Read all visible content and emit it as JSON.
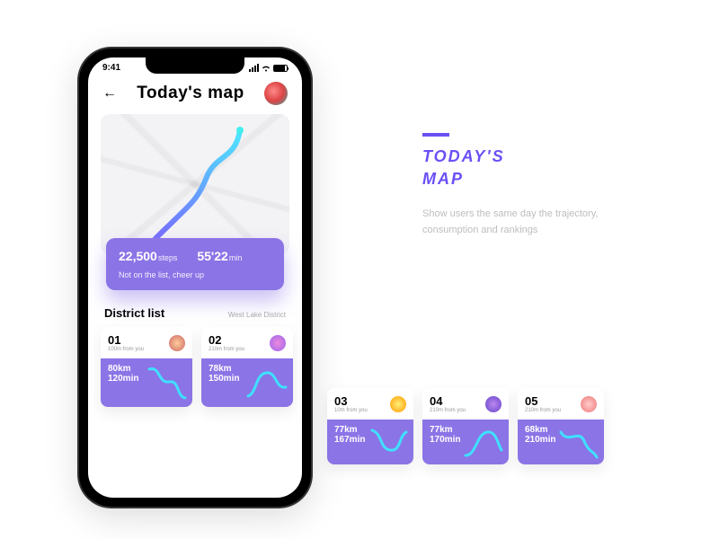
{
  "statusbar": {
    "time": "9:41"
  },
  "header": {
    "title": "Today's  map"
  },
  "stats": {
    "steps_value": "22,500",
    "steps_unit": "steps",
    "time_value": "55'22",
    "time_unit": "min",
    "message": "Not on the list,  cheer up"
  },
  "district": {
    "title": "District list",
    "location": "West Lake District",
    "cards": [
      {
        "rank": "01",
        "distance_from": "100m from you",
        "km": "80km",
        "min": "120min"
      },
      {
        "rank": "02",
        "distance_from": "210m from you",
        "km": "78km",
        "min": "150min"
      },
      {
        "rank": "03",
        "distance_from": "10m from you",
        "km": "77km",
        "min": "167min"
      },
      {
        "rank": "04",
        "distance_from": "210m from you",
        "km": "77km",
        "min": "170min"
      },
      {
        "rank": "05",
        "distance_from": "210m from you",
        "km": "68km",
        "min": "210min"
      }
    ]
  },
  "promo": {
    "title_line1": "TODAY'S",
    "title_line2": "MAP",
    "desc": "Show users the same day the trajectory, consumption and rankings"
  },
  "colors": {
    "accent": "#8b74e6",
    "brand": "#6b4ff5"
  }
}
